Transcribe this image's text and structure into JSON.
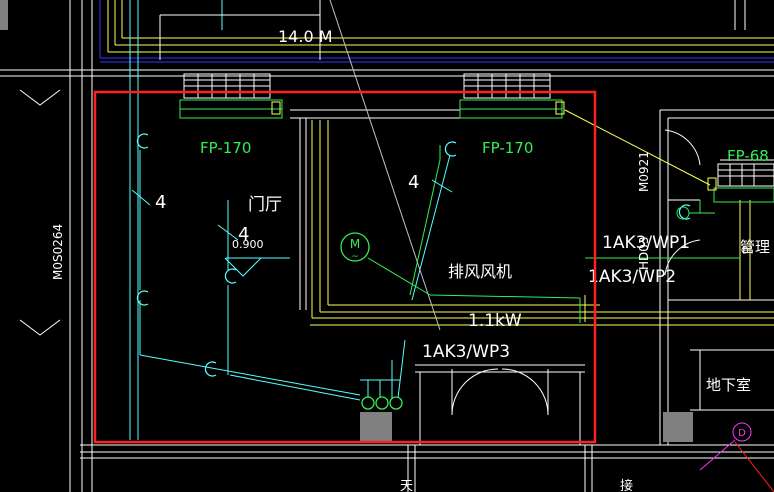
{
  "drawing": {
    "dimension_top": "14.0 M",
    "room_door_hall": "门厅",
    "elevation_mark": "0.900",
    "room_management": "管理",
    "room_basement": "地下室",
    "room_bottom_left_partial": "天",
    "room_bottom_right_partial": "接",
    "axis_marker_label": "D",
    "fan_coil_units": [
      {
        "label": "FP-170"
      },
      {
        "label": "FP-170"
      },
      {
        "label": "FP-68"
      }
    ],
    "wire_count_labels": [
      "4",
      "4",
      "4"
    ],
    "exhaust_fan": {
      "name": "排风风机",
      "power": "1.1kW",
      "motor_symbol": "M",
      "motor_sub": "~",
      "circuit": "1AK3/WP3"
    },
    "circuits": [
      "1AK3/WP1",
      "1AK3/WP2"
    ],
    "vertical_labels": {
      "left_door": "M0S0264",
      "right_door": "M0921",
      "right_door_lower": "HD03"
    }
  },
  "colors": {
    "background": "#000000",
    "wall": "#ffffff",
    "yellow_line": "#ffff55",
    "cyan_line": "#55ffff",
    "green_text": "#33ee55",
    "selection_red": "#ff2020",
    "magenta": "#ff33ff",
    "blue_line": "#3333ff",
    "grey_block": "#808080"
  }
}
